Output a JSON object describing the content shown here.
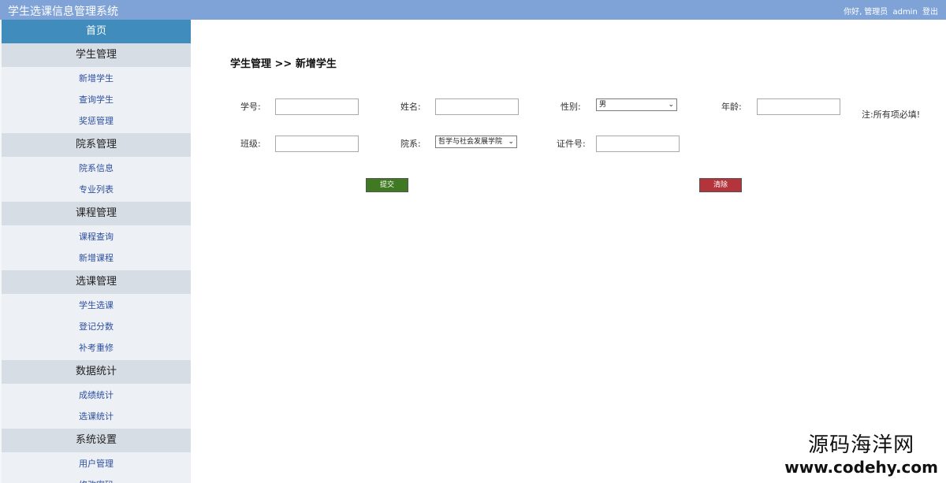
{
  "header": {
    "title": "学生选课信息管理系统",
    "greeting": "你好,",
    "role": "管理员",
    "username": "admin",
    "logout": "登出"
  },
  "sidebar": {
    "home": "首页",
    "groups": [
      {
        "title": "学生管理",
        "items": [
          "新增学生",
          "查询学生",
          "奖惩管理"
        ]
      },
      {
        "title": "院系管理",
        "items": [
          "院系信息",
          "专业列表"
        ]
      },
      {
        "title": "课程管理",
        "items": [
          "课程查询",
          "新增课程"
        ]
      },
      {
        "title": "选课管理",
        "items": [
          "学生选课",
          "登记分数",
          "补考重修"
        ]
      },
      {
        "title": "数据统计",
        "items": [
          "成绩统计",
          "选课统计"
        ]
      },
      {
        "title": "系统设置",
        "items": [
          "用户管理",
          "修改密码"
        ]
      }
    ]
  },
  "main": {
    "breadcrumb": "学生管理 >> 新增学生",
    "form": {
      "student_no_label": "学号:",
      "student_no_value": "",
      "name_label": "姓名:",
      "name_value": "",
      "gender_label": "性别:",
      "gender_value": "男",
      "age_label": "年龄:",
      "age_value": "",
      "class_label": "班级:",
      "class_value": "",
      "dept_label": "院系:",
      "dept_value": "哲学与社会发展学院",
      "id_label": "证件号:",
      "id_value": ""
    },
    "note": "注:所有项必填!",
    "submit_label": "提交",
    "clear_label": "清除"
  },
  "watermark": {
    "name": "源码海洋网",
    "url": "www.codehy.com"
  }
}
